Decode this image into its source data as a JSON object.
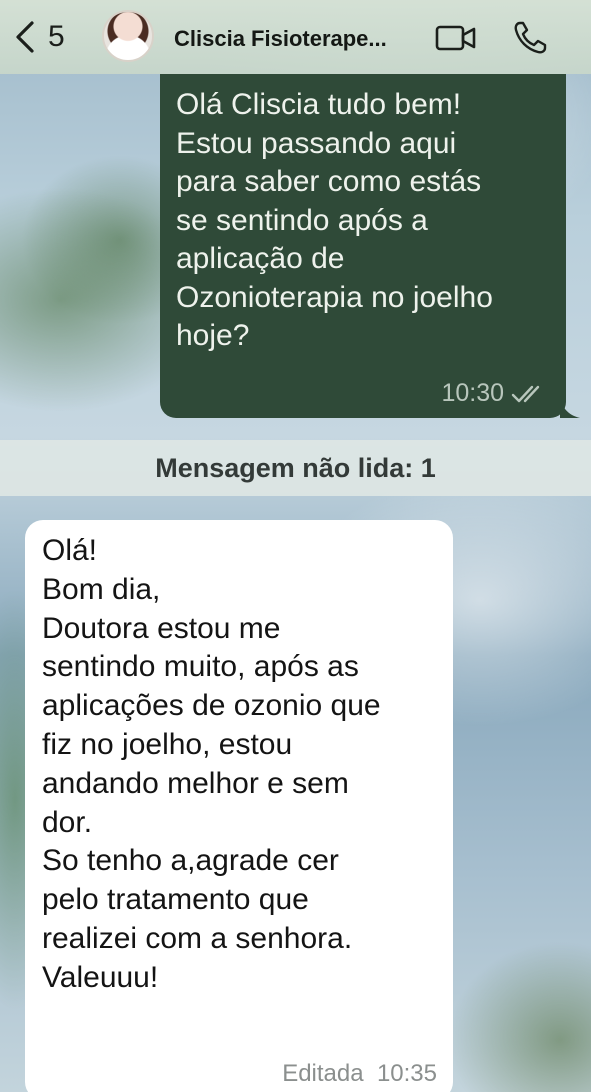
{
  "header": {
    "back_count": "5",
    "contact_name": "Cliscia Fisioterape...",
    "icons": [
      "chevron-left-icon",
      "avatar",
      "video-call-icon",
      "phone-icon"
    ]
  },
  "messages": [
    {
      "direction": "outgoing",
      "text": "Olá Cliscia tudo bem!\nEstou passando aqui\npara saber como estás\nse sentindo após a\naplicação de\nOzonioterapia no joelho\nhoje?",
      "time": "10:30",
      "status": "read-ticks"
    },
    {
      "direction": "incoming",
      "text": "Olá!\nBom dia,\nDoutora estou me\nsentindo muito, após as\naplicações de ozonio que\nfiz no joelho, estou\nandando melhor e sem\ndor.\nSo tenho a,agrade cer\npelo tratamento que\nrealizei com a senhora.\nValeuuu!",
      "edited_label": "Editada",
      "time": "10:35"
    }
  ],
  "unread_divider": "Mensagem não lida: 1",
  "colors": {
    "outgoing_bubble": "#2f4a38",
    "incoming_bubble": "#ffffff",
    "header_bg": "#d6e2d5"
  }
}
